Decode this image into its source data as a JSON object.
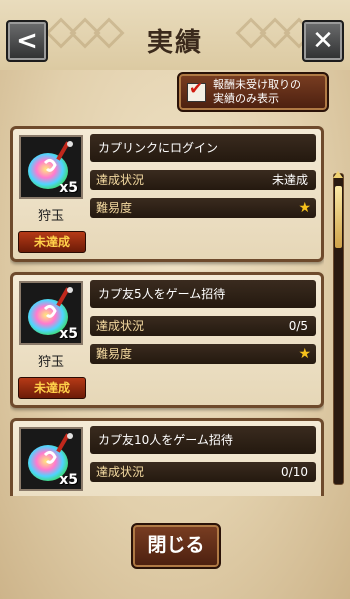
{
  "header": {
    "title": "実績"
  },
  "nav": {
    "back_icon": "back-arrow-icon",
    "close_icon": "close-x-icon"
  },
  "filter": {
    "line1": "報酬未受け取りの",
    "line2": "実績のみ表示",
    "checked": true
  },
  "achievements": [
    {
      "title": "カプリンクにログイン",
      "status_label": "達成状況",
      "status_value": "未達成",
      "difficulty_label": "難易度",
      "difficulty_stars": 1,
      "reward_name": "狩玉",
      "reward_qty": "x5",
      "badge": "未達成"
    },
    {
      "title": "カプ友5人をゲーム招待",
      "status_label": "達成状況",
      "status_value": "0/5",
      "difficulty_label": "難易度",
      "difficulty_stars": 1,
      "reward_name": "狩玉",
      "reward_qty": "x5",
      "badge": "未達成"
    },
    {
      "title": "カプ友10人をゲーム招待",
      "status_label": "達成状況",
      "status_value": "0/10",
      "reward_qty": "x5"
    }
  ],
  "footer": {
    "close_label": "閉じる"
  },
  "colors": {
    "accent_star": "#f6c21c",
    "badge_text": "#ffd04a"
  }
}
